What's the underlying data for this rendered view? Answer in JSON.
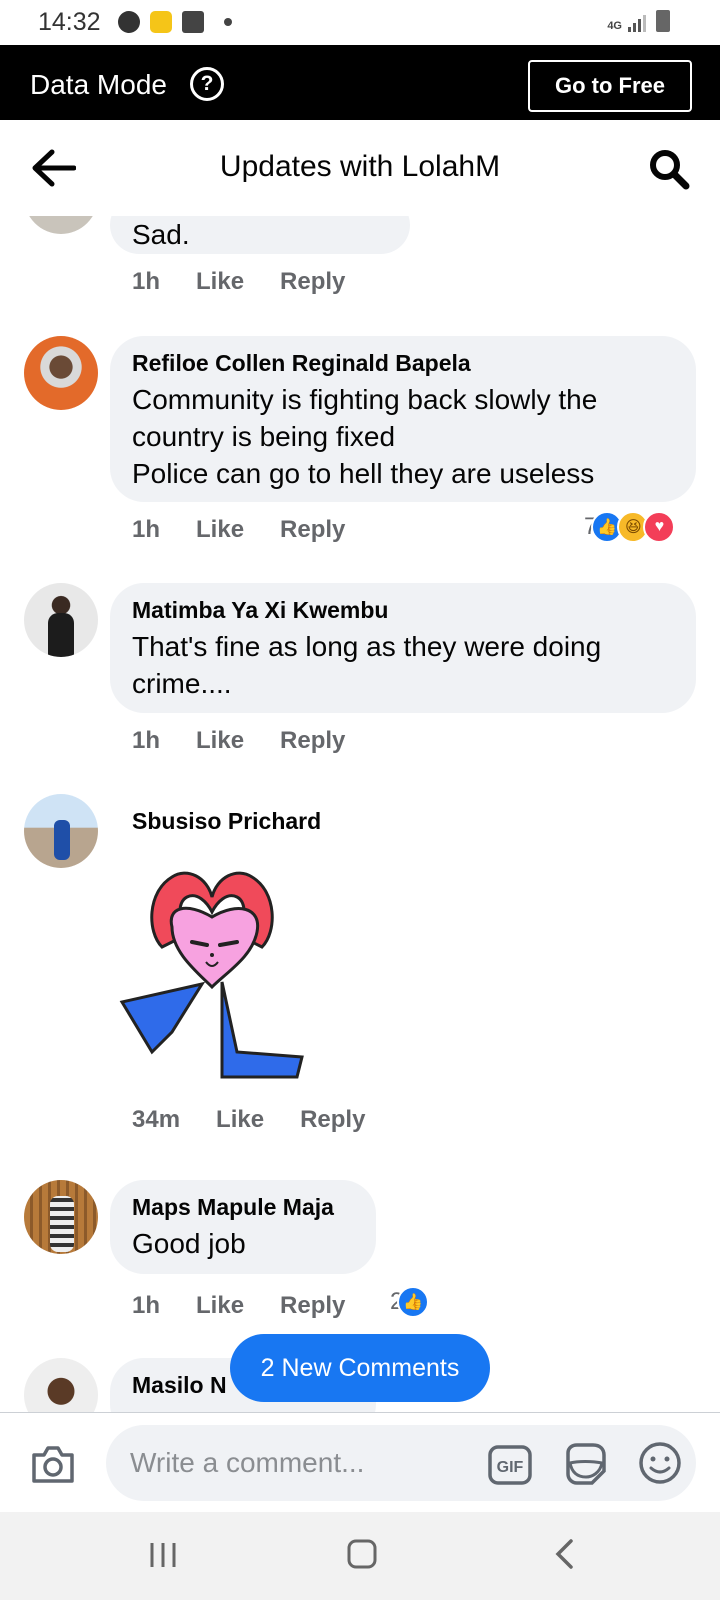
{
  "status_bar": {
    "time": "14:32",
    "network": "4G"
  },
  "data_mode": {
    "title": "Data Mode",
    "help_glyph": "?",
    "go_free_label": "Go to Free"
  },
  "header": {
    "title": "Updates with LolahM"
  },
  "comments": [
    {
      "author": "",
      "text": "Sad.",
      "time": "1h",
      "like": "Like",
      "reply": "Reply"
    },
    {
      "author": "Refiloe Collen Reginald Bapela",
      "text": "Community is fighting back slowly the country is being fixed\nPolice can go to hell they are useless",
      "time": "1h",
      "like": "Like",
      "reply": "Reply",
      "reaction_count": "7",
      "reactions": [
        "like-icon",
        "haha-icon",
        "love-icon"
      ]
    },
    {
      "author": "Matimba Ya Xi Kwembu",
      "text": "That's fine as long as they were doing crime....",
      "time": "1h",
      "like": "Like",
      "reply": "Reply"
    },
    {
      "author": "Sbusiso Prichard",
      "text": "",
      "sticker": "heart-character-sticker",
      "time": "34m",
      "like": "Like",
      "reply": "Reply"
    },
    {
      "author": "Maps Mapule Maja",
      "text": "Good job",
      "time": "1h",
      "like": "Like",
      "reply": "Reply",
      "reaction_count": "2",
      "reactions": [
        "like-icon"
      ]
    },
    {
      "author": "Masilo N",
      "text": ""
    }
  ],
  "new_comments_label": "2 New Comments",
  "composer": {
    "placeholder": "Write a comment...",
    "gif_label": "GIF"
  },
  "colors": {
    "accent": "#1877f2",
    "bubble": "#f0f2f5",
    "meta": "#65676b",
    "data_bar": "#000000"
  }
}
